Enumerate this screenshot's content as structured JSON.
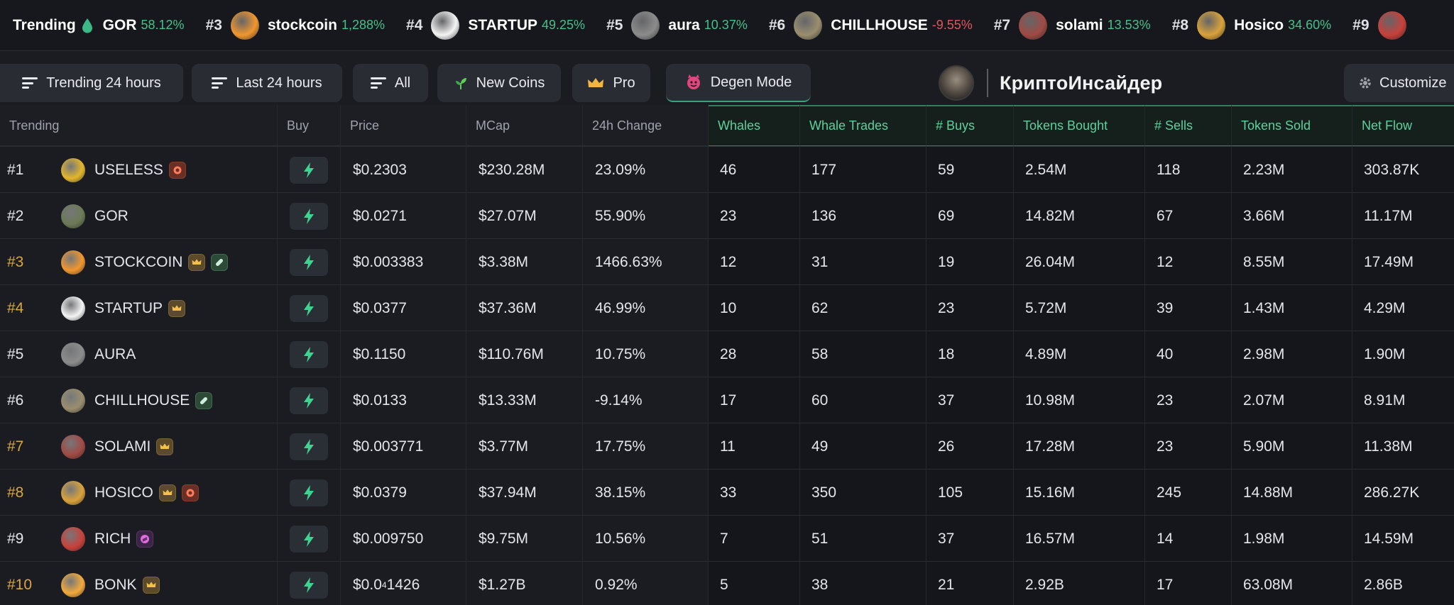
{
  "ticker": {
    "label": "Trending",
    "items": [
      {
        "rank": "",
        "sym": "GOR",
        "pct": "58.12%",
        "dir": "pos",
        "color": "#6b7a55"
      },
      {
        "rank": "#3",
        "sym": "stockcoin",
        "pct": "1,288%",
        "dir": "pos",
        "color": "#f0962e"
      },
      {
        "rank": "#4",
        "sym": "STARTUP",
        "pct": "49.25%",
        "dir": "pos",
        "color": "#f4f4f4"
      },
      {
        "rank": "#5",
        "sym": "aura",
        "pct": "10.37%",
        "dir": "pos",
        "color": "#8c8c8c"
      },
      {
        "rank": "#6",
        "sym": "CHILLHOUSE",
        "pct": "-9.55%",
        "dir": "neg",
        "color": "#9a8e6e"
      },
      {
        "rank": "#7",
        "sym": "solami",
        "pct": "13.53%",
        "dir": "pos",
        "color": "#a04a44"
      },
      {
        "rank": "#8",
        "sym": "Hosico",
        "pct": "34.60%",
        "dir": "pos",
        "color": "#d9a23a"
      },
      {
        "rank": "#9",
        "sym": "",
        "pct": "",
        "dir": "pos",
        "color": "#c8413b"
      }
    ]
  },
  "toolbar": {
    "trending": "Trending 24 hours",
    "last": "Last 24 hours",
    "all": "All",
    "new_coins": "New Coins",
    "pro": "Pro",
    "degen": "Degen Mode",
    "brand": "КриптоИнсайдер",
    "customize": "Customize"
  },
  "table": {
    "headers": {
      "trending": "Trending",
      "buy": "Buy",
      "price": "Price",
      "mcap": "MCap",
      "change": "24h Change",
      "whales": "Whales",
      "whale_trades": "Whale Trades",
      "buys": "# Buys",
      "tokens_bought": "Tokens Bought",
      "sells": "# Sells",
      "tokens_sold": "Tokens Sold",
      "net_flow": "Net Flow"
    },
    "rows": [
      {
        "rank": "#1",
        "gold": false,
        "name": "USELESS",
        "avatar": "#e2b62c",
        "badges": [
          "red"
        ],
        "price": "$0.2303",
        "mcap": "$230.28M",
        "change": "23.09%",
        "dir": "pos",
        "whales": "46",
        "whale_trades": "177",
        "buys": "59",
        "tokens_bought": "2.54M",
        "sells": "118",
        "tokens_sold": "2.23M",
        "net_flow": "303.87K"
      },
      {
        "rank": "#2",
        "gold": false,
        "name": "GOR",
        "avatar": "#6b7a55",
        "badges": [],
        "price": "$0.0271",
        "mcap": "$27.07M",
        "change": "55.90%",
        "dir": "pos",
        "whales": "23",
        "whale_trades": "136",
        "buys": "69",
        "tokens_bought": "14.82M",
        "sells": "67",
        "tokens_sold": "3.66M",
        "net_flow": "11.17M"
      },
      {
        "rank": "#3",
        "gold": true,
        "name": "STOCKCOIN",
        "avatar": "#f0962e",
        "badges": [
          "crown",
          "pill"
        ],
        "price": "$0.003383",
        "mcap": "$3.38M",
        "change": "1466.63%",
        "dir": "pos",
        "whales": "12",
        "whale_trades": "31",
        "buys": "19",
        "tokens_bought": "26.04M",
        "sells": "12",
        "tokens_sold": "8.55M",
        "net_flow": "17.49M"
      },
      {
        "rank": "#4",
        "gold": true,
        "name": "STARTUP",
        "avatar": "#f4f4f4",
        "badges": [
          "crown"
        ],
        "price": "$0.0377",
        "mcap": "$37.36M",
        "change": "46.99%",
        "dir": "pos",
        "whales": "10",
        "whale_trades": "62",
        "buys": "23",
        "tokens_bought": "5.72M",
        "sells": "39",
        "tokens_sold": "1.43M",
        "net_flow": "4.29M"
      },
      {
        "rank": "#5",
        "gold": false,
        "name": "AURA",
        "avatar": "#8c8c8c",
        "badges": [],
        "price": "$0.1150",
        "mcap": "$110.76M",
        "change": "10.75%",
        "dir": "pos",
        "whales": "28",
        "whale_trades": "58",
        "buys": "18",
        "tokens_bought": "4.89M",
        "sells": "40",
        "tokens_sold": "2.98M",
        "net_flow": "1.90M"
      },
      {
        "rank": "#6",
        "gold": false,
        "name": "CHILLHOUSE",
        "avatar": "#9a8e6e",
        "badges": [
          "pill"
        ],
        "price": "$0.0133",
        "mcap": "$13.33M",
        "change": "-9.14%",
        "dir": "neg",
        "whales": "17",
        "whale_trades": "60",
        "buys": "37",
        "tokens_bought": "10.98M",
        "sells": "23",
        "tokens_sold": "2.07M",
        "net_flow": "8.91M"
      },
      {
        "rank": "#7",
        "gold": true,
        "name": "SOLAMI",
        "avatar": "#a04a44",
        "badges": [
          "crown"
        ],
        "price": "$0.003771",
        "mcap": "$3.77M",
        "change": "17.75%",
        "dir": "pos",
        "whales": "11",
        "whale_trades": "49",
        "buys": "26",
        "tokens_bought": "17.28M",
        "sells": "23",
        "tokens_sold": "5.90M",
        "net_flow": "11.38M"
      },
      {
        "rank": "#8",
        "gold": true,
        "name": "HOSICO",
        "avatar": "#d9a23a",
        "badges": [
          "crown",
          "red"
        ],
        "price": "$0.0379",
        "mcap": "$37.94M",
        "change": "38.15%",
        "dir": "pos",
        "whales": "33",
        "whale_trades": "350",
        "buys": "105",
        "tokens_bought": "15.16M",
        "sells": "245",
        "tokens_sold": "14.88M",
        "net_flow": "286.27K"
      },
      {
        "rank": "#9",
        "gold": false,
        "name": "RICH",
        "avatar": "#c8413b",
        "badges": [
          "purple"
        ],
        "price": "$0.009750",
        "mcap": "$9.75M",
        "change": "10.56%",
        "dir": "pos",
        "whales": "7",
        "whale_trades": "51",
        "buys": "37",
        "tokens_bought": "16.57M",
        "sells": "14",
        "tokens_sold": "1.98M",
        "net_flow": "14.59M"
      },
      {
        "rank": "#10",
        "gold": true,
        "name": "BONK",
        "avatar": "#f2a93b",
        "badges": [
          "crown"
        ],
        "price": "$0.0",
        "price_sub": "4",
        "price_tail": "1426",
        "mcap": "$1.27B",
        "change": "0.92%",
        "dir": "pos",
        "whales": "5",
        "whale_trades": "38",
        "buys": "21",
        "tokens_bought": "2.92B",
        "sells": "17",
        "tokens_sold": "63.08M",
        "net_flow": "2.86B"
      }
    ]
  }
}
